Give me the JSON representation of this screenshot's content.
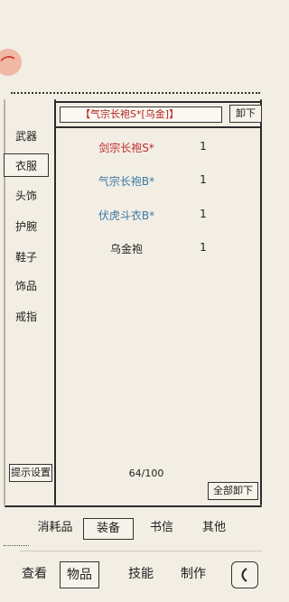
{
  "equipped": {
    "label": "【气宗长袍S*[乌金]】",
    "unequip": "卸下"
  },
  "categories": [
    "武器",
    "衣服",
    "头饰",
    "护腕",
    "鞋子",
    "饰品",
    "戒指"
  ],
  "active_category": "衣服",
  "items": [
    {
      "name": "剑宗长袍S*",
      "qty": "1",
      "color": "#c0282d"
    },
    {
      "name": "气宗长袍B*",
      "qty": "1",
      "color": "#3a78a6"
    },
    {
      "name": "伏虎斗衣B*",
      "qty": "1",
      "color": "#3a78a6"
    },
    {
      "name": "乌金袍",
      "qty": "1",
      "color": "#222222"
    }
  ],
  "capacity": "64/100",
  "hint_settings": "提示设置",
  "unequip_all": "全部卸下",
  "bag_tabs": [
    "消耗品",
    "装备",
    "书信",
    "其他"
  ],
  "active_bag_tab": "装备",
  "nav": [
    "查看",
    "物品",
    "技能",
    "制作"
  ],
  "active_nav": "物品",
  "colors": {
    "background": "#f3eee4",
    "line": "#2c2c2c",
    "rare_red": "#c0282d",
    "rare_blue": "#3a78a6"
  },
  "icons": {
    "top_left": "red-seal-icon",
    "corner": "back-arrow-icon"
  }
}
